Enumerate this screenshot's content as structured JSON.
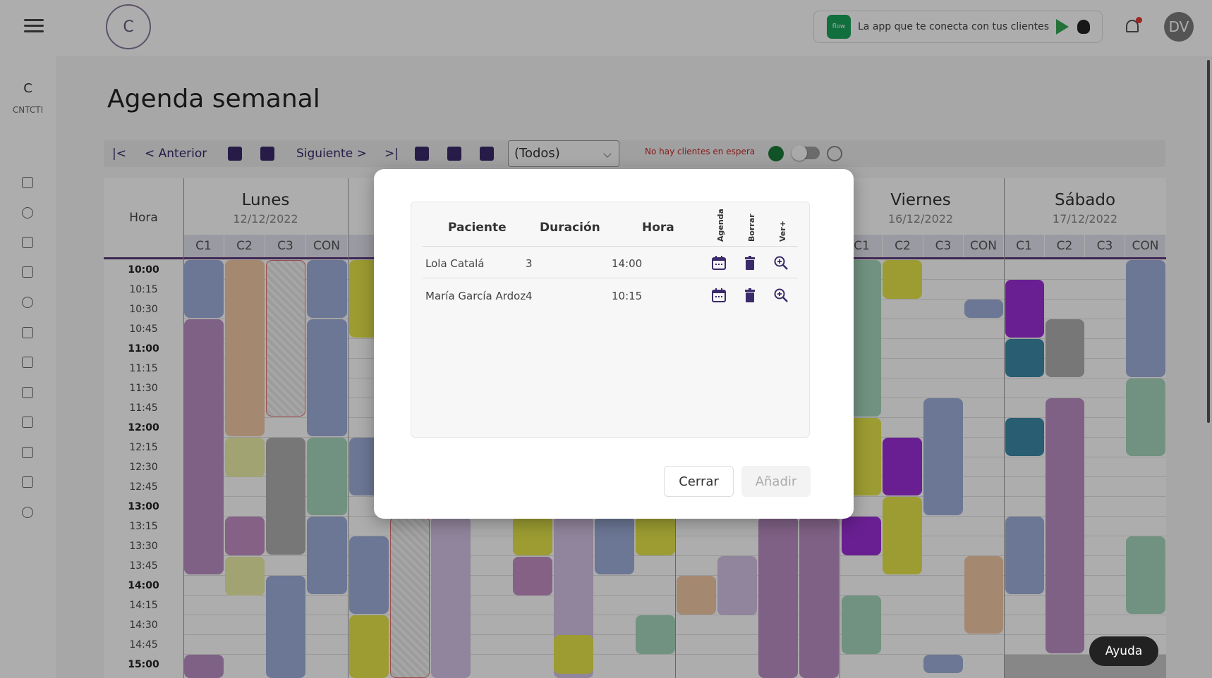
{
  "topbar": {
    "promo_text": "La app que te conecta con tus clientes",
    "avatar_initials": "DV",
    "logo_letter": "C"
  },
  "sidebar": {
    "letter": "C",
    "code": "CNTCTI"
  },
  "page": {
    "title": "Agenda semanal"
  },
  "toolbar": {
    "prev_label": "Anterior",
    "next_label": "Siguiente",
    "filter_value": "(Todos)",
    "waiting_text": "No hay clientes en espera"
  },
  "grid": {
    "hora_label": "Hora",
    "days": [
      {
        "name": "Lunes",
        "date": "12/12/2022"
      },
      {
        "name": "Viernes",
        "date": "16/12/2022"
      },
      {
        "name": "Sábado",
        "date": "17/12/2022"
      }
    ],
    "subcols": [
      "C1",
      "C2",
      "C3",
      "CON"
    ],
    "times": [
      "10:00",
      "10:15",
      "10:30",
      "10:45",
      "11:00",
      "11:15",
      "11:30",
      "11:45",
      "12:00",
      "12:15",
      "12:30",
      "12:45",
      "13:00",
      "13:15",
      "13:30",
      "13:45",
      "14:00",
      "14:15",
      "14:30",
      "14:45",
      "15:00"
    ]
  },
  "modal": {
    "headers": {
      "patient": "Paciente",
      "duration": "Duración",
      "time": "Hora",
      "agenda": "Agenda",
      "delete": "Borrar",
      "more": "Ver+"
    },
    "rows": [
      {
        "patient": "Lola Catalá",
        "duration": "3",
        "time": "14:00"
      },
      {
        "patient": "María García Ardoz",
        "duration": "4",
        "time": "10:15"
      }
    ],
    "close_label": "Cerrar",
    "add_label": "Añadir"
  },
  "help_label": "Ayuda",
  "colors": {
    "primary": "#3a2a6a",
    "waiting": "#c62828"
  }
}
